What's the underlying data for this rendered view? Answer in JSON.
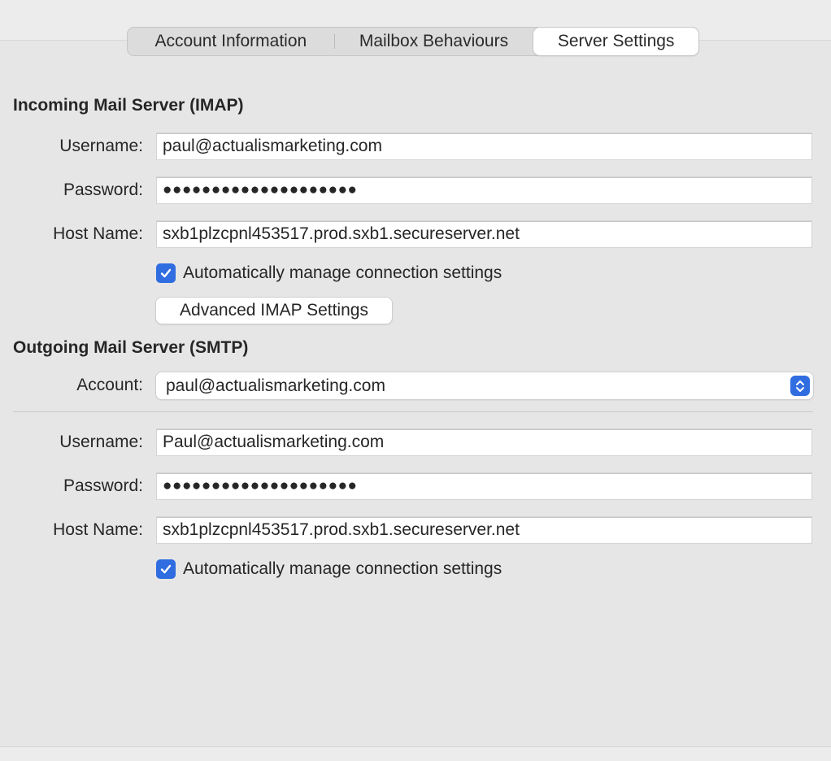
{
  "tabs": [
    {
      "label": "Account Information"
    },
    {
      "label": "Mailbox Behaviours"
    },
    {
      "label": "Server Settings",
      "selected": true
    }
  ],
  "incoming": {
    "title": "Incoming Mail Server (IMAP)",
    "username_label": "Username:",
    "username_value": "paul@actualismarketing.com",
    "password_label": "Password:",
    "password_value": "●●●●●●●●●●●●●●●●●●●●",
    "host_label": "Host Name:",
    "host_value": "sxb1plzcpnl453517.prod.sxb1.secureserver.net",
    "auto_manage_label": "Automatically manage connection settings",
    "auto_manage_checked": true,
    "advanced_button_label": "Advanced IMAP Settings"
  },
  "outgoing": {
    "title": "Outgoing Mail Server (SMTP)",
    "account_label": "Account:",
    "account_value": "paul@actualismarketing.com",
    "username_label": "Username:",
    "username_value": "Paul@actualismarketing.com",
    "password_label": "Password:",
    "password_value": "●●●●●●●●●●●●●●●●●●●●",
    "host_label": "Host Name:",
    "host_value": "sxb1plzcpnl453517.prod.sxb1.secureserver.net",
    "auto_manage_label": "Automatically manage connection settings",
    "auto_manage_checked": true
  },
  "colors": {
    "accent": "#2f6de0",
    "background": "#e6e6e6"
  },
  "icons": {
    "checkbox": "checkmark-icon",
    "select": "chevron-up-down-icon"
  }
}
